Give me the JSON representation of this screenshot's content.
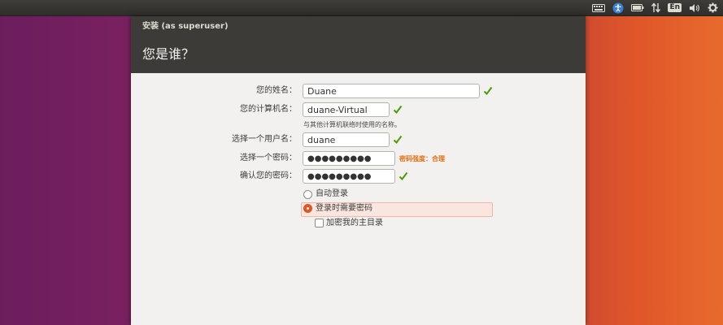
{
  "window": {
    "title": "安装 (as superuser)",
    "heading": "您是谁？"
  },
  "form": {
    "name_label": "您的姓名：",
    "name_value": "Duane",
    "computer_label": "您的计算机名：",
    "computer_value": "duane-Virtual",
    "computer_hint": "与其他计算机联络时使用的名称。",
    "username_label": "选择一个用户名：",
    "username_value": "duane",
    "password_label": "选择一个密码：",
    "password_value": "●●●●●●●●●",
    "password_strength": "密码强度：合理",
    "confirm_label": "确认您的密码：",
    "confirm_value": "●●●●●●●●●"
  },
  "login_options": {
    "auto_login": "自动登录",
    "require_password": "登录时需要密码",
    "encrypt_home": "加密我的主目录",
    "selected": "require_password",
    "encrypt_checked": false
  },
  "tray": {
    "icons": [
      "keyboard-icon",
      "accessibility-icon",
      "battery-icon",
      "network-icon",
      "language-icon",
      "volume-icon",
      "gear-icon"
    ],
    "language_badge": "En"
  },
  "colors": {
    "accent": "#e95420",
    "check_green": "#4e9a06",
    "strength_orange": "#e36e10",
    "titlebar": "#3c3b37"
  }
}
